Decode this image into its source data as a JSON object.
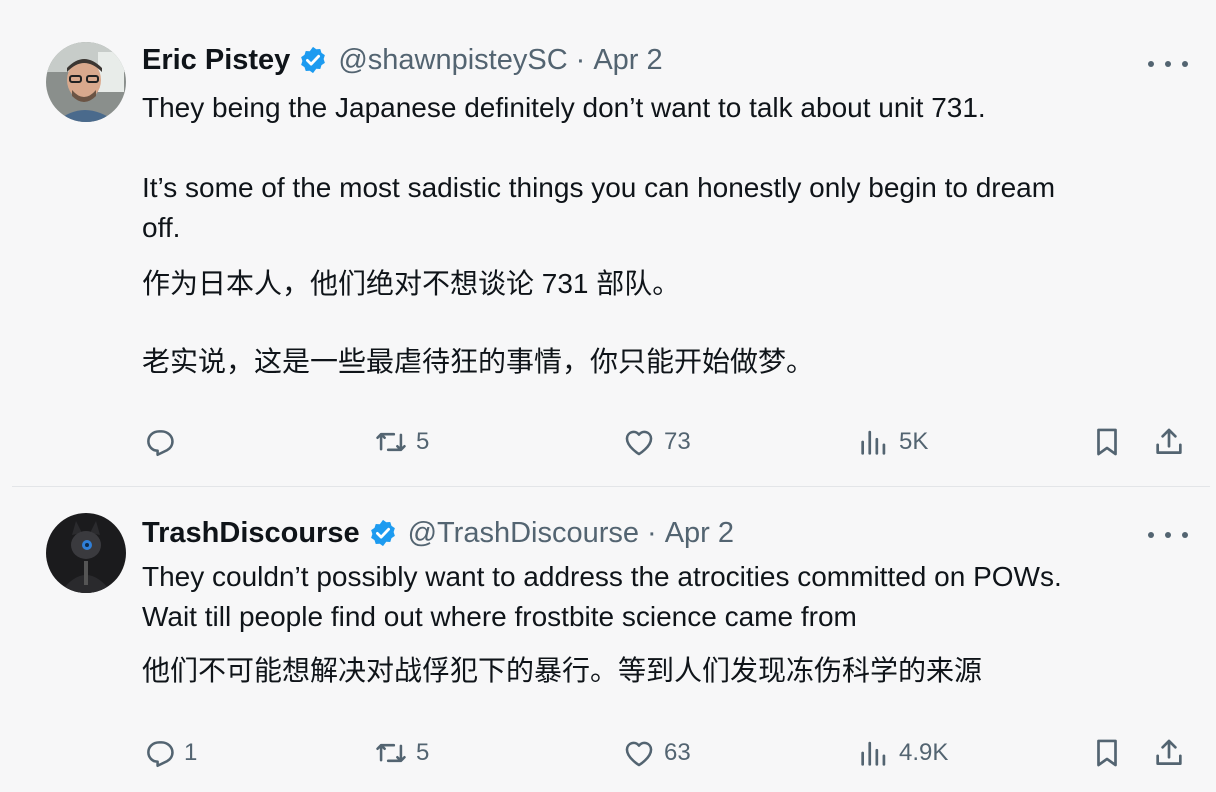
{
  "tweets": [
    {
      "name": "Eric Pistey",
      "handle": "@shawnpisteySC",
      "separator": "·",
      "date": "Apr 2",
      "text_en_1": "They being the Japanese definitely don’t want to talk about unit 731.",
      "text_en_2a": "It’s some of the most sadistic things you can honestly only begin to dream",
      "text_en_2b": "off.",
      "text_zh_1": "作为日本人，他们绝对不想谈论 731 部队。",
      "text_zh_2": "老实说，这是一些最虐待狂的事情，你只能开始做梦。",
      "replies": "",
      "reposts": "5",
      "likes": "73",
      "views": "5K"
    },
    {
      "name": "TrashDiscourse",
      "handle": "@TrashDiscourse",
      "separator": "·",
      "date": "Apr 2",
      "text_en_1": "They couldn’t possibly want to address the atrocities committed on POWs.",
      "text_en_2": "Wait till people find out where frostbite science came from",
      "text_zh_1": "他们不可能想解决对战俘犯下的暴行。等到人们发现冻伤科学的来源",
      "replies": "1",
      "reposts": "5",
      "likes": "63",
      "views": "4.9K"
    }
  ],
  "icons": {
    "verified": "verified-badge-icon",
    "reply": "reply-icon",
    "repost": "repost-icon",
    "like": "heart-icon",
    "views": "views-icon",
    "bookmark": "bookmark-icon",
    "share": "share-icon",
    "more": "more-icon"
  },
  "colors": {
    "verified": "#1d9bf0",
    "secondary_text": "#536471",
    "primary_text": "#0f1419"
  }
}
